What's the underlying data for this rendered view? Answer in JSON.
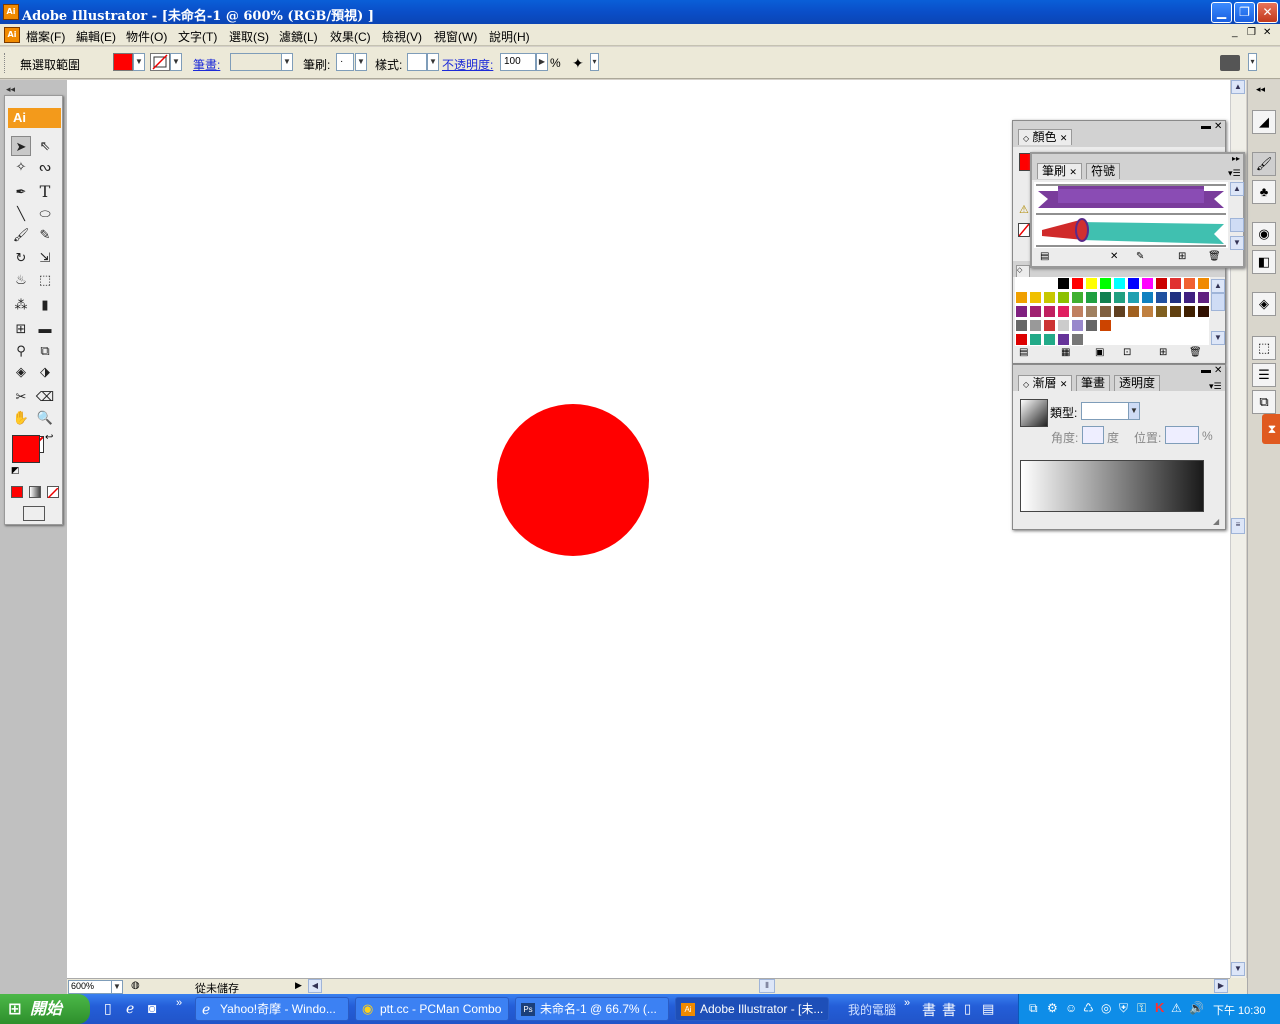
{
  "window": {
    "title": "Adobe Illustrator - [未命名-1 @ 600% (RGB/預視) ]"
  },
  "menu": [
    "檔案(F)",
    "編輯(E)",
    "物件(O)",
    "文字(T)",
    "選取(S)",
    "濾鏡(L)",
    "效果(C)",
    "檢視(V)",
    "視窗(W)",
    "說明(H)"
  ],
  "control": {
    "selection": "無選取範圍",
    "stroke_label": "筆畫:",
    "brush_label": "筆刷:",
    "brush_value": "·",
    "style_label": "樣式:",
    "opacity_label": "不透明度:",
    "opacity_value": "100",
    "percent": "%"
  },
  "colors": {
    "fill": "#ff0000",
    "circle": "#ff0000",
    "titlebar": "#0a4ec8",
    "ai_orange": "#f39a1b"
  },
  "toolbox": {
    "header": "Ai"
  },
  "status": {
    "zoom": "600%",
    "save_state": "從未儲存"
  },
  "panels": {
    "color": {
      "tab": "顏色"
    },
    "brushes": {
      "tab1": "筆刷",
      "tab2": "符號"
    },
    "gradient": {
      "tab1": "漸層",
      "tab2": "筆畫",
      "tab3": "透明度",
      "type_label": "類型:",
      "angle_label": "角度:",
      "angle_unit": "度",
      "location_label": "位置:",
      "location_unit": "%"
    }
  },
  "taskbar": {
    "start": "開始",
    "items": [
      "Yahoo!奇摩 - Windo...",
      "ptt.cc - PCMan Combo",
      "未命名-1 @ 66.7% (...",
      "Adobe Illustrator - [未..."
    ],
    "mycomputer": "我的電腦",
    "clock": "下午 10:30"
  }
}
